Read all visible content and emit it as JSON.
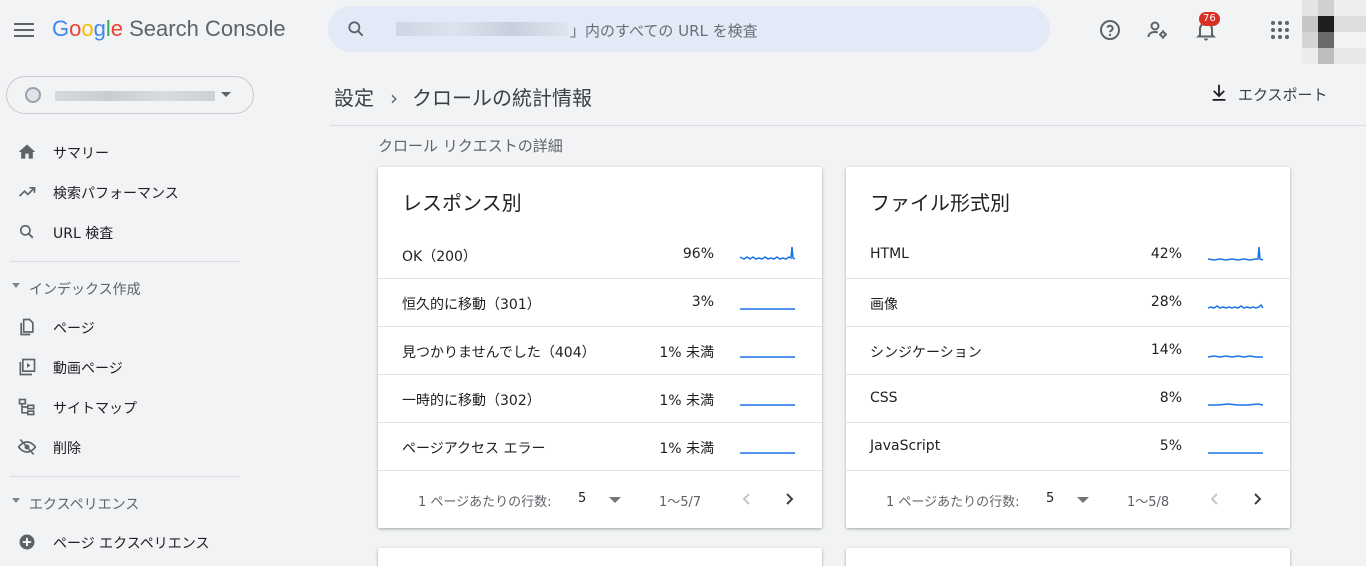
{
  "header": {
    "app_name_prefix": "Google",
    "app_name_suffix": " Search Console",
    "search_placeholder": "」内のすべての URL を検査",
    "notifications_count": "76"
  },
  "sidebar": {
    "items": [
      {
        "label": "サマリー",
        "icon": "home-icon"
      },
      {
        "label": "検索パフォーマンス",
        "icon": "trending-up-icon"
      },
      {
        "label": "URL 検査",
        "icon": "search-icon"
      }
    ],
    "sections": [
      {
        "label": "インデックス作成",
        "items": [
          {
            "label": "ページ",
            "icon": "pages-icon"
          },
          {
            "label": "動画ページ",
            "icon": "video-pages-icon"
          },
          {
            "label": "サイトマップ",
            "icon": "sitemap-icon"
          },
          {
            "label": "削除",
            "icon": "removal-icon"
          }
        ]
      },
      {
        "label": "エクスペリエンス",
        "items": [
          {
            "label": "ページ エクスペリエンス",
            "icon": "plus-circle-icon"
          }
        ]
      }
    ]
  },
  "main": {
    "breadcrumb_parent": "設定",
    "breadcrumb_current": "クロールの統計情報",
    "export_label": "エクスポート",
    "subheading": "クロール リクエストの詳細",
    "cards": [
      {
        "title": "レスポンス別",
        "rows": [
          {
            "label": "OK（200）",
            "value": "96%"
          },
          {
            "label": "恒久的に移動（301）",
            "value": "3%"
          },
          {
            "label": "見つかりませんでした（404）",
            "value": "1% 未満"
          },
          {
            "label": "一時的に移動（302）",
            "value": "1% 未満"
          },
          {
            "label": "ページアクセス エラー",
            "value": "1% 未満"
          }
        ],
        "rows_per_page_label": "1 ページあたりの行数:",
        "rows_per_page": "5",
        "range": "1～5/7"
      },
      {
        "title": "ファイル形式別",
        "rows": [
          {
            "label": "HTML",
            "value": "42%"
          },
          {
            "label": "画像",
            "value": "28%"
          },
          {
            "label": "シンジケーション",
            "value": "14%"
          },
          {
            "label": "CSS",
            "value": "8%"
          },
          {
            "label": "JavaScript",
            "value": "5%"
          }
        ],
        "rows_per_page_label": "1 ページあたりの行数:",
        "rows_per_page": "5",
        "range": "1～5/8"
      }
    ]
  },
  "colors": {
    "sparkline": "#1a73e8",
    "badge": "#d93025",
    "search_bg": "#e3e9f7"
  }
}
